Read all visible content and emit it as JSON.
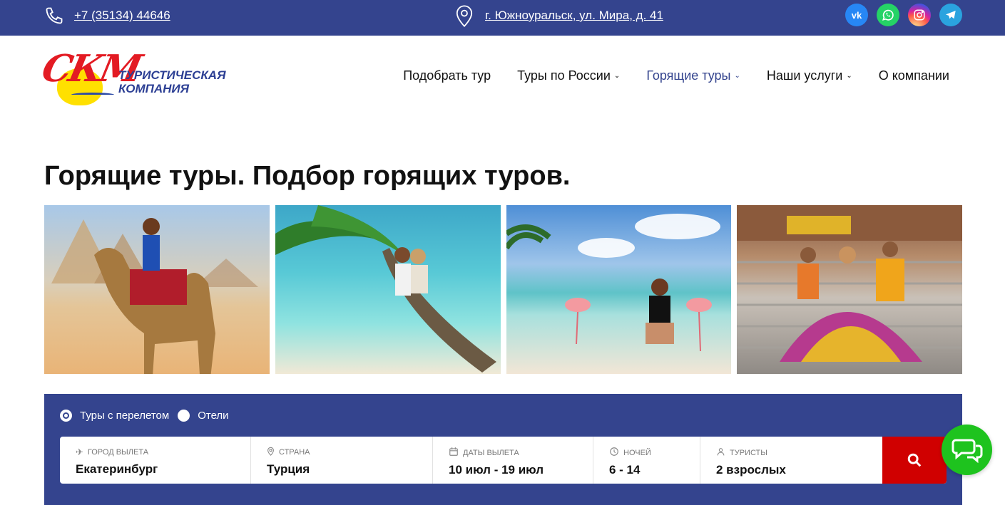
{
  "topbar": {
    "phone": "+7 (35134) 44646",
    "address": "г. Южноуральск, ул. Мира, д. 41",
    "socials": [
      {
        "name": "vk",
        "label": "vk"
      },
      {
        "name": "whatsapp",
        "label": ""
      },
      {
        "name": "instagram",
        "label": ""
      },
      {
        "name": "telegram",
        "label": ""
      }
    ]
  },
  "logo": {
    "mark": "СКМ",
    "line1": "ТУРИСТИЧЕСКАЯ",
    "line2": "КОМПАНИЯ"
  },
  "nav": {
    "items": [
      {
        "label": "Подобрать тур",
        "has_dropdown": false
      },
      {
        "label": "Туры по России",
        "has_dropdown": true
      },
      {
        "label": "Горящие туры",
        "has_dropdown": true,
        "active": true
      },
      {
        "label": "Наши услуги",
        "has_dropdown": true
      },
      {
        "label": "О компании",
        "has_dropdown": false
      }
    ]
  },
  "page": {
    "title": "Горящие туры. Подбор горящих туров."
  },
  "search": {
    "modes": [
      {
        "label": "Туры с перелетом",
        "checked": true
      },
      {
        "label": "Отели",
        "checked": false
      }
    ],
    "fields": [
      {
        "caption": "Город вылета",
        "value": "Екатеринбург",
        "icon": "plane-icon"
      },
      {
        "caption": "Страна",
        "value": "Турция",
        "icon": "location-pin-icon"
      },
      {
        "caption": "Даты вылета",
        "value": "10 июл - 19 июл",
        "icon": "calendar-icon"
      },
      {
        "caption": "Ночей",
        "value": "6 - 14",
        "icon": "clock-icon"
      },
      {
        "caption": "Туристы",
        "value": "2 взрослых",
        "icon": "user-icon"
      }
    ]
  },
  "colors": {
    "brand_blue": "#34448e",
    "search_red": "#d00000",
    "chat_green": "#1ec31e"
  }
}
